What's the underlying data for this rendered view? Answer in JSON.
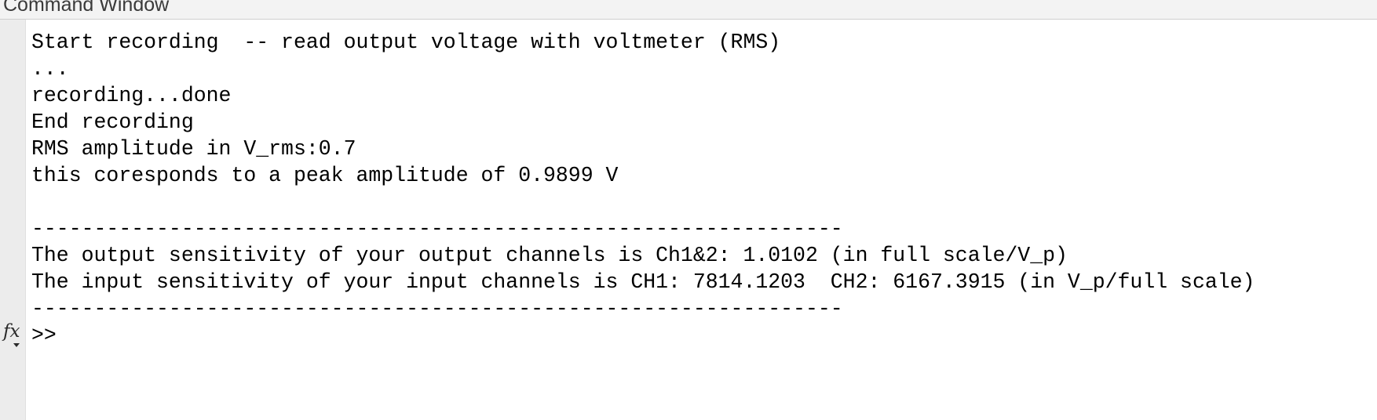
{
  "window": {
    "title": "Command Window"
  },
  "console": {
    "lines": [
      "Start recording  -- read output voltage with voltmeter (RMS)",
      "...",
      "recording...done",
      "End recording",
      "RMS amplitude in V_rms:0.7",
      "this coresponds to a peak amplitude of 0.9899 V",
      "",
      "-----------------------------------------------------------------",
      "The output sensitivity of your output channels is Ch1&2: 1.0102 (in full scale/V_p)",
      "The input sensitivity of your input channels is CH1: 7814.1203  CH2: 6167.3915 (in V_p/full scale)",
      "-----------------------------------------------------------------"
    ],
    "prompt": ">>",
    "function_browser_icon": "fx-icon"
  },
  "colors": {
    "titlebar_bg": "#f3f3f3",
    "gutter_bg": "#ececec",
    "text": "#000000"
  }
}
